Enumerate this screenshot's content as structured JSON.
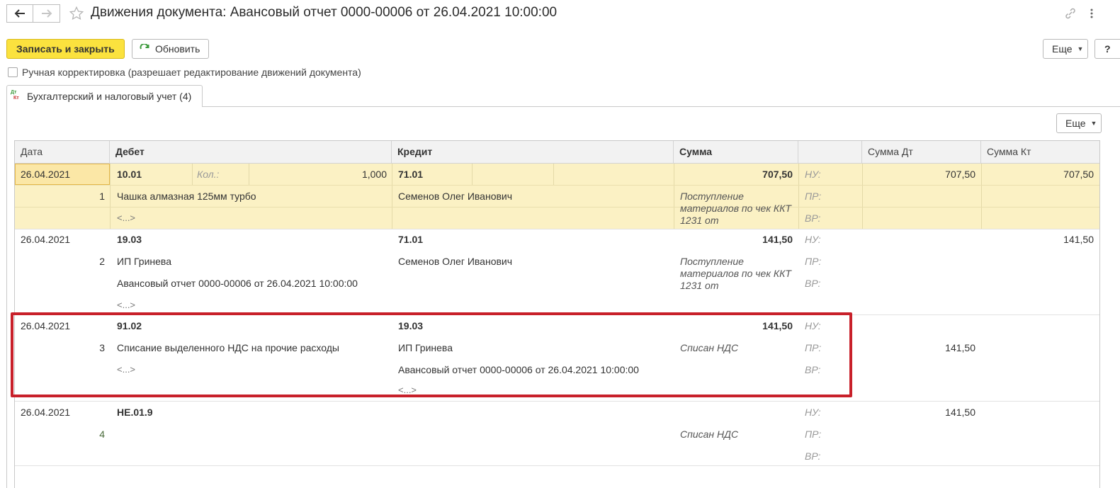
{
  "window": {
    "title": "Движения документа: Авансовый отчет 0000-00006 от 26.04.2021 10:00:00"
  },
  "toolbar": {
    "save_close_label": "Записать и закрыть",
    "refresh_label": "Обновить",
    "more_label": "Еще",
    "help_label": "?"
  },
  "manual_correction": {
    "label": "Ручная корректировка (разрешает редактирование движений документа)",
    "checked": false
  },
  "tabs": [
    {
      "icon_text": "Дт Кт",
      "label": "Бухгалтерский и налоговый учет (4)"
    }
  ],
  "table": {
    "more_label": "Еще",
    "columns": [
      "Дата",
      "Дебет",
      "Кредит",
      "Сумма",
      "",
      "Сумма Дт",
      "Сумма Кт"
    ],
    "labels": {
      "nu": "НУ:",
      "pr": "ПР:",
      "vr": "ВР:",
      "kol": "Кол.:",
      "ellipsis": "<...>"
    },
    "rows": [
      {
        "date": "26.04.2021",
        "num": "1",
        "debit_account": "10.01",
        "debit_qty": "1,000",
        "debit_sub1": "Чашка алмазная 125мм турбо",
        "credit_account": "71.01",
        "credit_sub1": "Семенов Олег Иванович",
        "amount": "707,50",
        "content": "Поступление материалов по чек ККТ 1231 от",
        "sum_dt_nu": "707,50",
        "sum_kt_nu": "707,50"
      },
      {
        "date": "26.04.2021",
        "num": "2",
        "debit_account": "19.03",
        "debit_sub1": "ИП Гринева",
        "debit_sub2": "Авансовый отчет 0000-00006 от 26.04.2021 10:00:00",
        "credit_account": "71.01",
        "credit_sub1": "Семенов Олег Иванович",
        "amount": "141,50",
        "content": "Поступление материалов по чек ККТ 1231 от",
        "sum_kt_nu": "141,50"
      },
      {
        "date": "26.04.2021",
        "num": "3",
        "debit_account": "91.02",
        "debit_sub1": "Списание выделенного НДС на прочие расходы",
        "credit_account": "19.03",
        "credit_sub1": "ИП Гринева",
        "credit_sub2": "Авансовый отчет 0000-00006 от 26.04.2021 10:00:00",
        "amount": "141,50",
        "content": "Списан НДС",
        "sum_dt_pr": "141,50"
      },
      {
        "date": "26.04.2021",
        "num": "4",
        "debit_account": "НЕ.01.9",
        "content": "Списан НДС",
        "sum_dt_nu": "141,50"
      }
    ]
  },
  "colors": {
    "primary_button": "#fbe23e",
    "selected_row": "#fbf1c4",
    "highlight_frame": "#c8202a",
    "refresh_icon": "#3d9a3d"
  }
}
